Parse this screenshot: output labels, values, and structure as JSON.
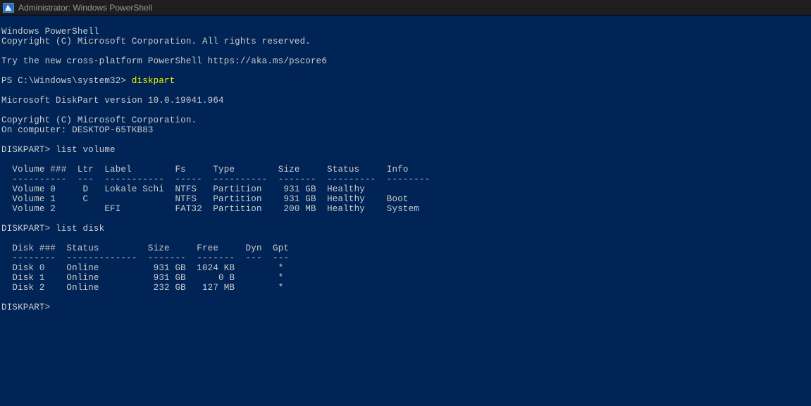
{
  "titlebar": {
    "title": "Administrator: Windows PowerShell"
  },
  "header": {
    "line1": "Windows PowerShell",
    "line2": "Copyright (C) Microsoft Corporation. All rights reserved.",
    "line3": "Try the new cross-platform PowerShell https://aka.ms/pscore6"
  },
  "prompt1": {
    "prefix": "PS C:\\Windows\\system32> ",
    "command": "diskpart"
  },
  "diskpart_header": {
    "version": "Microsoft DiskPart version 10.0.19041.964",
    "copyright": "Copyright (C) Microsoft Corporation.",
    "computer": "On computer: DESKTOP-65TKB83"
  },
  "prompt2": {
    "full": "DISKPART> list volume"
  },
  "volume_table": {
    "header": "  Volume ###  Ltr  Label        Fs     Type        Size     Status     Info",
    "divider": "  ----------  ---  -----------  -----  ----------  -------  ---------  --------",
    "rows": [
      "  Volume 0     D   Lokale Schi  NTFS   Partition    931 GB  Healthy",
      "  Volume 1     C                NTFS   Partition    931 GB  Healthy    Boot",
      "  Volume 2         EFI          FAT32  Partition    200 MB  Healthy    System"
    ]
  },
  "prompt3": {
    "full": "DISKPART> list disk"
  },
  "disk_table": {
    "header": "  Disk ###  Status         Size     Free     Dyn  Gpt",
    "divider": "  --------  -------------  -------  -------  ---  ---",
    "rows": [
      "  Disk 0    Online          931 GB  1024 KB        *",
      "  Disk 1    Online          931 GB      0 B        *",
      "  Disk 2    Online          232 GB   127 MB        *"
    ]
  },
  "prompt4": {
    "full": "DISKPART>"
  }
}
